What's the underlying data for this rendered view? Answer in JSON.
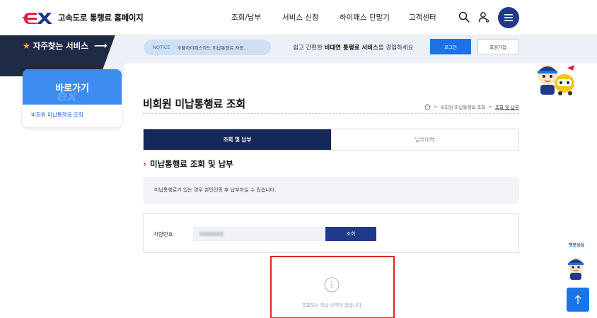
{
  "header": {
    "logo_text": "고속도로 통행료 홈페이지",
    "nav": [
      "조회/납부",
      "서비스 신청",
      "하이패스 단말기",
      "고객센터"
    ],
    "icons": [
      "search-icon",
      "user-icon",
      "menu-icon"
    ]
  },
  "banner": {
    "favorites_label": "자주찾는 서비스",
    "notice_tag": "NOTICE",
    "notice_text": "후불하이패스카드 미납통행료 자동...",
    "promo_before": "쉽고 간편한 ",
    "promo_bold": "비대면 통행료 서비스",
    "promo_after": "를 경험하세요",
    "login_label": "로그인",
    "join_label": "회원가입"
  },
  "shortcut": {
    "title": "바로가기",
    "item": "비회원 미납통행료 조회"
  },
  "page": {
    "title": "비회원 미납통행료 조회",
    "breadcrumb": [
      "비회원 미납통행료 조회",
      "조회 및 납부"
    ]
  },
  "tabs": [
    {
      "label": "조회 및 납부",
      "active": true
    },
    {
      "label": "납부내역",
      "active": false
    }
  ],
  "section": {
    "title": "미납통행료 조회 및 납부",
    "info": "미납통행료가 있는 경우 본인인증 후 납부하실 수 있습니다."
  },
  "form": {
    "label": "차량번호",
    "search_label": "조회"
  },
  "result": {
    "message": "조회되는 미납 내역이 없습니다."
  },
  "side": {
    "chat_label": "챗봇상담"
  },
  "colors": {
    "brand_red": "#e41e3f",
    "navy": "#16285a",
    "blue": "#1a73e8",
    "highlight_border": "#e02424"
  }
}
